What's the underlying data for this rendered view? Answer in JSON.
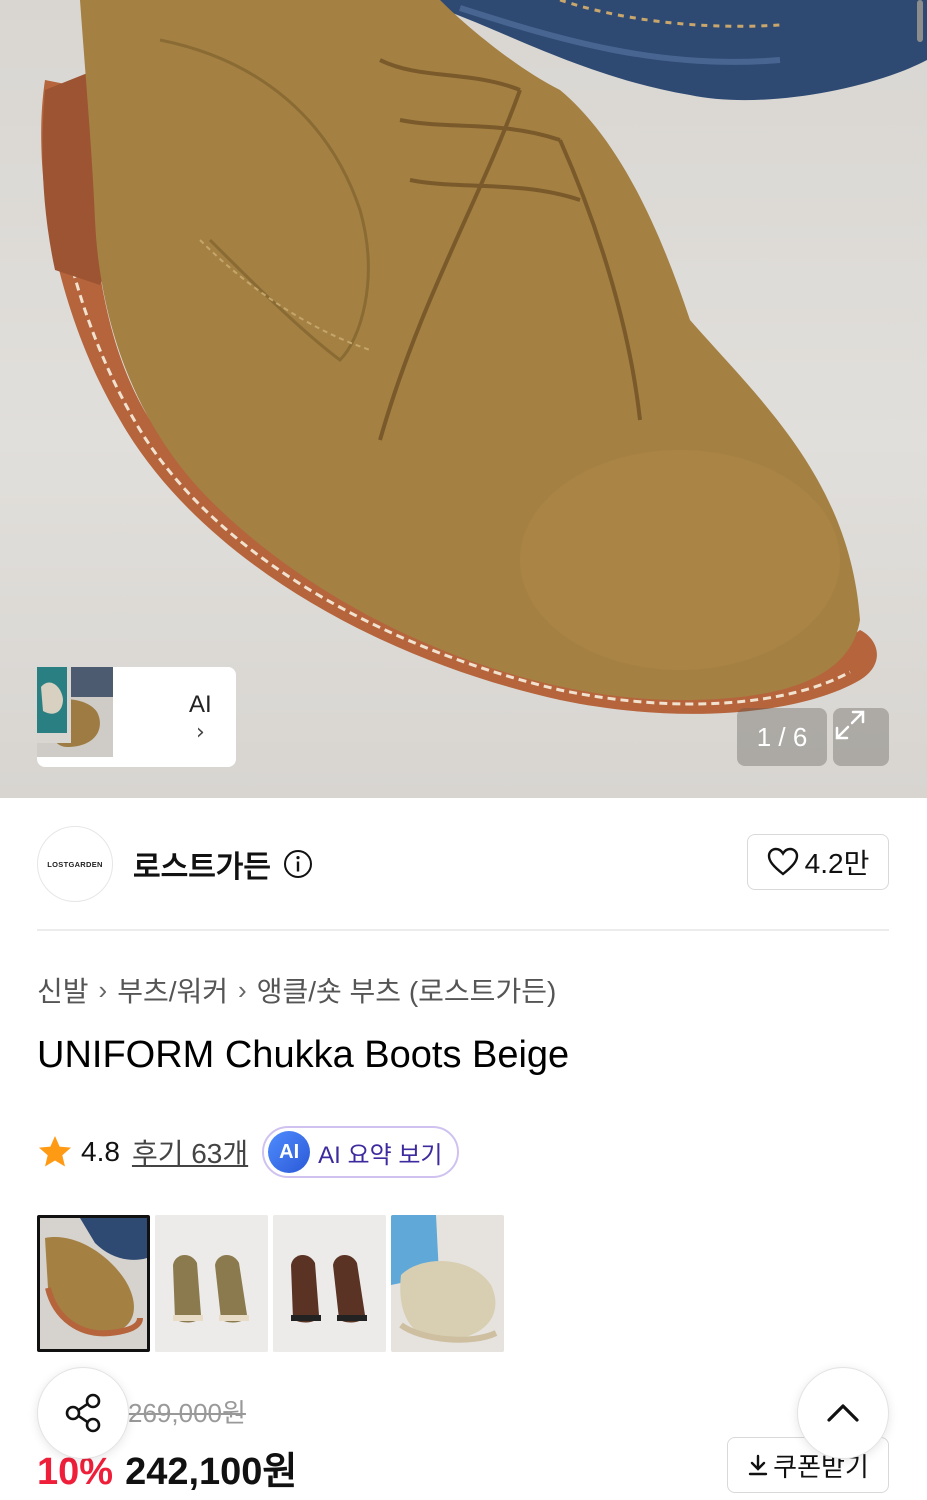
{
  "gallery": {
    "ai_label": "AI",
    "counter": "1 / 6"
  },
  "brand": {
    "logo_text": "LOSTGARDEN",
    "name": "로스트가든",
    "like_count": "4.2만"
  },
  "breadcrumb": [
    "신발",
    "부츠/워커",
    "앵클/숏 부츠 (로스트가든)"
  ],
  "product": {
    "title": "UNIFORM Chukka Boots Beige"
  },
  "rating": {
    "score": "4.8",
    "reviews": "후기 63개",
    "ai_badge": "AI",
    "ai_summary": "AI 요약 보기"
  },
  "price": {
    "original": "269,000원",
    "discount": "10%",
    "final": "242,100원"
  },
  "coupon": {
    "label": "쿠폰받기"
  },
  "colors": {
    "discount": "#ef1f3a",
    "ai_accent": "#3c2a9e"
  }
}
